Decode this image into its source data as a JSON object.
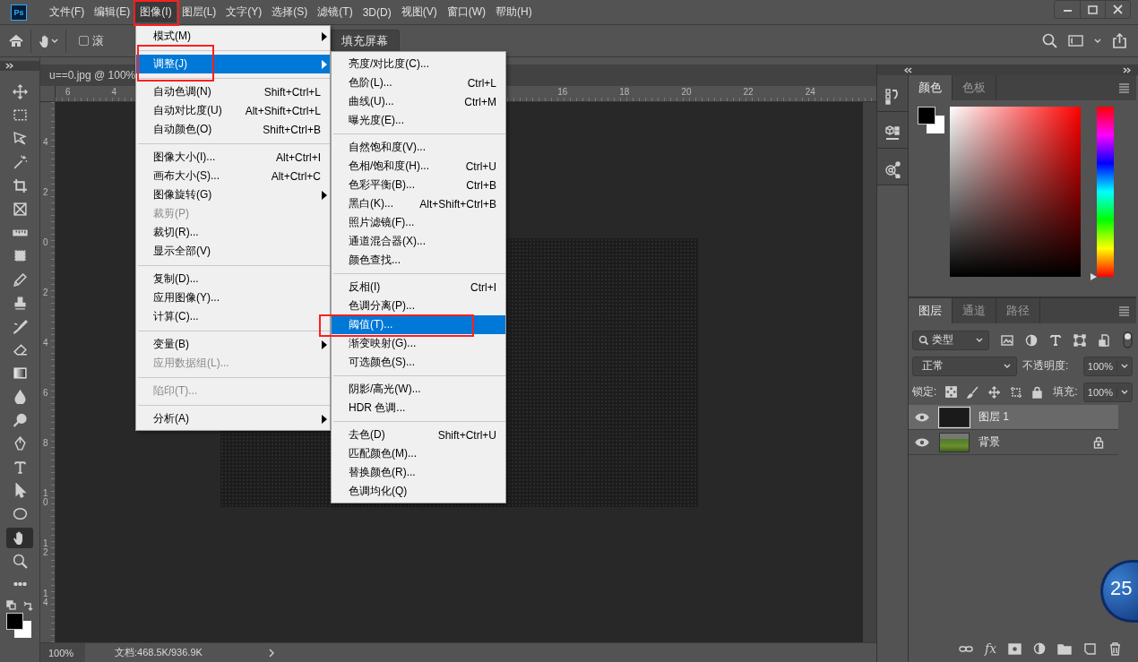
{
  "app_logo": "Ps",
  "menubar": [
    {
      "label": "文件(F)",
      "selected": false,
      "annotated": false
    },
    {
      "label": "编辑(E)",
      "selected": false,
      "annotated": false
    },
    {
      "label": "图像(I)",
      "selected": true,
      "annotated": true
    },
    {
      "label": "图层(L)",
      "selected": false,
      "annotated": false
    },
    {
      "label": "文字(Y)",
      "selected": false,
      "annotated": false
    },
    {
      "label": "选择(S)",
      "selected": false,
      "annotated": false
    },
    {
      "label": "滤镜(T)",
      "selected": false,
      "annotated": false
    },
    {
      "label": "3D(D)",
      "selected": false,
      "annotated": false
    },
    {
      "label": "视图(V)",
      "selected": false,
      "annotated": false
    },
    {
      "label": "窗口(W)",
      "selected": false,
      "annotated": false
    },
    {
      "label": "帮助(H)",
      "selected": false,
      "annotated": false
    }
  ],
  "options_bar": {
    "scroll_checkbox": {
      "label": "滚",
      "checked": false
    },
    "fill_screen_button": "填充屏幕"
  },
  "document_tab": "u==0.jpg @ 100%",
  "top_ruler": {
    "left_labels": [
      "6",
      "4"
    ],
    "right_labels": [
      "16",
      "18",
      "20",
      "22",
      "24"
    ]
  },
  "left_ruler": [
    "4",
    "2",
    "0",
    "2",
    "4",
    "6",
    "8",
    "10",
    "12",
    "14"
  ],
  "tools": [
    {
      "kind": "move",
      "selected": false
    },
    {
      "kind": "marquee",
      "selected": false
    },
    {
      "kind": "lasso",
      "selected": false
    },
    {
      "kind": "wand",
      "selected": false
    },
    {
      "kind": "crop",
      "selected": false
    },
    {
      "kind": "frame",
      "selected": false
    },
    {
      "kind": "ruler",
      "selected": false
    },
    {
      "kind": "patch",
      "selected": false
    },
    {
      "kind": "pencil",
      "selected": false
    },
    {
      "kind": "stamp",
      "selected": false
    },
    {
      "kind": "brush",
      "selected": false
    },
    {
      "kind": "eraser",
      "selected": false
    },
    {
      "kind": "gradient",
      "selected": false
    },
    {
      "kind": "blur",
      "selected": false
    },
    {
      "kind": "dodge",
      "selected": false
    },
    {
      "kind": "pen",
      "selected": false
    },
    {
      "kind": "type",
      "selected": false
    },
    {
      "kind": "select",
      "selected": false
    },
    {
      "kind": "ellipse",
      "selected": false
    },
    {
      "kind": "hand",
      "selected": true
    },
    {
      "kind": "zoom",
      "selected": false
    },
    {
      "kind": "more",
      "selected": false
    }
  ],
  "status_bar": {
    "zoom": "100%",
    "doc_info": "文档:468.5K/936.9K"
  },
  "image_menu": [
    {
      "kind": "item",
      "label": "模式(M)",
      "submenu": true,
      "selected": false,
      "disabled": false,
      "annotated": false
    },
    {
      "kind": "separator"
    },
    {
      "kind": "item",
      "label": "调整(J)",
      "submenu": true,
      "selected": true,
      "disabled": false,
      "annotated": true
    },
    {
      "kind": "separator"
    },
    {
      "kind": "item",
      "label": "自动色调(N)",
      "shortcut": "Shift+Ctrl+L",
      "submenu": false,
      "selected": false,
      "disabled": false,
      "annotated": false
    },
    {
      "kind": "item",
      "label": "自动对比度(U)",
      "shortcut": "Alt+Shift+Ctrl+L",
      "submenu": false,
      "selected": false,
      "disabled": false,
      "annotated": false
    },
    {
      "kind": "item",
      "label": "自动颜色(O)",
      "shortcut": "Shift+Ctrl+B",
      "submenu": false,
      "selected": false,
      "disabled": false,
      "annotated": false
    },
    {
      "kind": "separator"
    },
    {
      "kind": "item",
      "label": "图像大小(I)...",
      "shortcut": "Alt+Ctrl+I",
      "submenu": false,
      "selected": false,
      "disabled": false,
      "annotated": false
    },
    {
      "kind": "item",
      "label": "画布大小(S)...",
      "shortcut": "Alt+Ctrl+C",
      "submenu": false,
      "selected": false,
      "disabled": false,
      "annotated": false
    },
    {
      "kind": "item",
      "label": "图像旋转(G)",
      "submenu": true,
      "selected": false,
      "disabled": false,
      "annotated": false
    },
    {
      "kind": "item",
      "label": "裁剪(P)",
      "submenu": false,
      "selected": false,
      "disabled": true,
      "annotated": false
    },
    {
      "kind": "item",
      "label": "裁切(R)...",
      "submenu": false,
      "selected": false,
      "disabled": false,
      "annotated": false
    },
    {
      "kind": "item",
      "label": "显示全部(V)",
      "submenu": false,
      "selected": false,
      "disabled": false,
      "annotated": false
    },
    {
      "kind": "separator"
    },
    {
      "kind": "item",
      "label": "复制(D)...",
      "submenu": false,
      "selected": false,
      "disabled": false,
      "annotated": false
    },
    {
      "kind": "item",
      "label": "应用图像(Y)...",
      "submenu": false,
      "selected": false,
      "disabled": false,
      "annotated": false
    },
    {
      "kind": "item",
      "label": "计算(C)...",
      "submenu": false,
      "selected": false,
      "disabled": false,
      "annotated": false
    },
    {
      "kind": "separator"
    },
    {
      "kind": "item",
      "label": "变量(B)",
      "submenu": true,
      "selected": false,
      "disabled": false,
      "annotated": false
    },
    {
      "kind": "item",
      "label": "应用数据组(L)...",
      "submenu": false,
      "selected": false,
      "disabled": true,
      "annotated": false
    },
    {
      "kind": "separator"
    },
    {
      "kind": "item",
      "label": "陷印(T)...",
      "submenu": false,
      "selected": false,
      "disabled": true,
      "annotated": false
    },
    {
      "kind": "separator"
    },
    {
      "kind": "item",
      "label": "分析(A)",
      "submenu": true,
      "selected": false,
      "disabled": false,
      "annotated": false
    }
  ],
  "adjust_submenu": [
    {
      "kind": "item",
      "label": "亮度/对比度(C)...",
      "selected": false,
      "annotated": false
    },
    {
      "kind": "item",
      "label": "色阶(L)...",
      "shortcut": "Ctrl+L",
      "selected": false,
      "annotated": false
    },
    {
      "kind": "item",
      "label": "曲线(U)...",
      "shortcut": "Ctrl+M",
      "selected": false,
      "annotated": false
    },
    {
      "kind": "item",
      "label": "曝光度(E)...",
      "selected": false,
      "annotated": false
    },
    {
      "kind": "separator"
    },
    {
      "kind": "item",
      "label": "自然饱和度(V)...",
      "selected": false,
      "annotated": false
    },
    {
      "kind": "item",
      "label": "色相/饱和度(H)...",
      "shortcut": "Ctrl+U",
      "selected": false,
      "annotated": false
    },
    {
      "kind": "item",
      "label": "色彩平衡(B)...",
      "shortcut": "Ctrl+B",
      "selected": false,
      "annotated": false
    },
    {
      "kind": "item",
      "label": "黑白(K)...",
      "shortcut": "Alt+Shift+Ctrl+B",
      "selected": false,
      "annotated": false
    },
    {
      "kind": "item",
      "label": "照片滤镜(F)...",
      "selected": false,
      "annotated": false
    },
    {
      "kind": "item",
      "label": "通道混合器(X)...",
      "selected": false,
      "annotated": false
    },
    {
      "kind": "item",
      "label": "颜色查找...",
      "selected": false,
      "annotated": false
    },
    {
      "kind": "separator"
    },
    {
      "kind": "item",
      "label": "反相(I)",
      "shortcut": "Ctrl+I",
      "selected": false,
      "annotated": false
    },
    {
      "kind": "item",
      "label": "色调分离(P)...",
      "selected": false,
      "annotated": false
    },
    {
      "kind": "item",
      "label": "阈值(T)...",
      "selected": true,
      "annotated": true
    },
    {
      "kind": "item",
      "label": "渐变映射(G)...",
      "selected": false,
      "annotated": false
    },
    {
      "kind": "item",
      "label": "可选颜色(S)...",
      "selected": false,
      "annotated": false
    },
    {
      "kind": "separator"
    },
    {
      "kind": "item",
      "label": "阴影/高光(W)...",
      "selected": false,
      "annotated": false
    },
    {
      "kind": "item",
      "label": "HDR 色调...",
      "selected": false,
      "annotated": false
    },
    {
      "kind": "separator"
    },
    {
      "kind": "item",
      "label": "去色(D)",
      "shortcut": "Shift+Ctrl+U",
      "selected": false,
      "annotated": false
    },
    {
      "kind": "item",
      "label": "匹配颜色(M)...",
      "selected": false,
      "annotated": false
    },
    {
      "kind": "item",
      "label": "替换颜色(R)...",
      "selected": false,
      "annotated": false
    },
    {
      "kind": "item",
      "label": "色调均化(Q)",
      "selected": false,
      "annotated": false
    }
  ],
  "color_panel": {
    "tabs": [
      {
        "label": "颜色",
        "selected": true
      },
      {
        "label": "色板",
        "selected": false
      }
    ],
    "hue_slider": {
      "level": 0
    }
  },
  "layers_panel": {
    "tabs": [
      {
        "label": "图层",
        "selected": true
      },
      {
        "label": "通道",
        "selected": false
      },
      {
        "label": "路径",
        "selected": false
      }
    ],
    "filter": "类型",
    "blend_mode": "正常",
    "opacity_label": "不透明度:",
    "opacity": "100%",
    "lock_label": "锁定:",
    "fill_label": "填充:",
    "fill": "100%",
    "layers": [
      {
        "name": "图层 1",
        "kind": "noise",
        "selected": true,
        "visible": true,
        "locked": false
      },
      {
        "name": "背景",
        "kind": "photo",
        "selected": false,
        "visible": true,
        "locked": true
      }
    ],
    "fx_button": "fx"
  },
  "speed_widget": {
    "value": "25"
  }
}
